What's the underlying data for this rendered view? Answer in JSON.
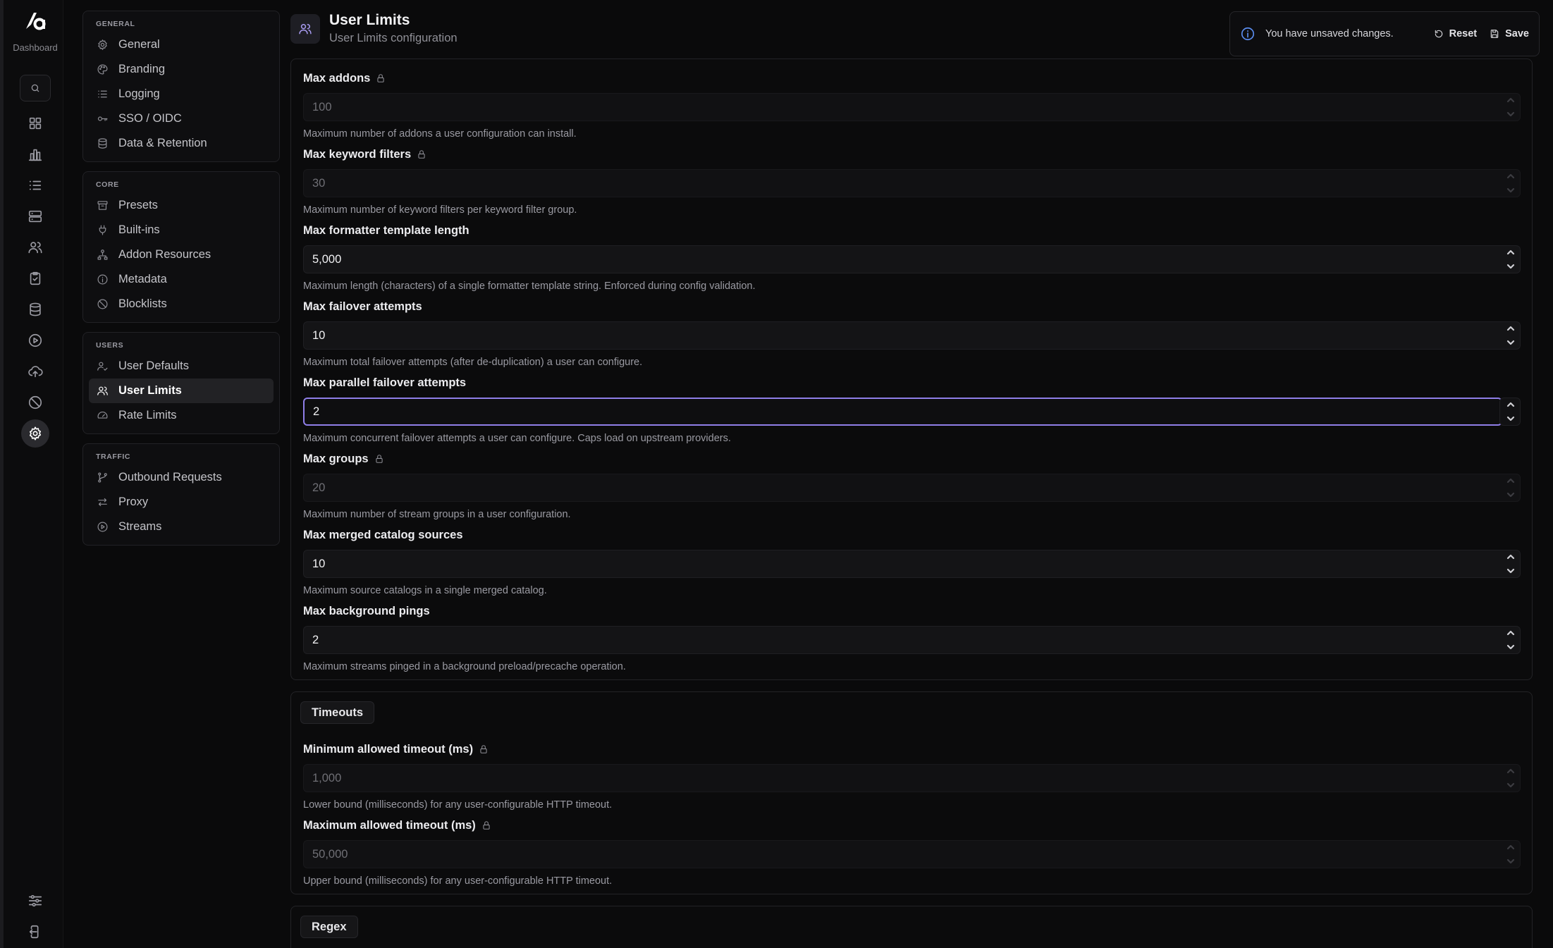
{
  "rail": {
    "logo_label": "Dashboard",
    "icons": [
      "search-icon",
      "grid-icon",
      "bar-chart-icon",
      "list-icon",
      "server-icon",
      "users-icon",
      "clipboard-check-icon",
      "database-icon",
      "play-circle-icon",
      "cloud-upload-icon",
      "ban-icon",
      "settings-icon",
      "sliders-icon",
      "logout-icon"
    ],
    "active": "settings-icon"
  },
  "nav": {
    "general": {
      "title": "GENERAL",
      "items": [
        {
          "label": "General",
          "icon": "gear-icon"
        },
        {
          "label": "Branding",
          "icon": "palette-icon"
        },
        {
          "label": "Logging",
          "icon": "list-icon"
        },
        {
          "label": "SSO / OIDC",
          "icon": "key-icon"
        },
        {
          "label": "Data & Retention",
          "icon": "database-icon"
        }
      ]
    },
    "core": {
      "title": "CORE",
      "items": [
        {
          "label": "Presets",
          "icon": "archive-icon"
        },
        {
          "label": "Built-ins",
          "icon": "plug-icon"
        },
        {
          "label": "Addon Resources",
          "icon": "network-icon"
        },
        {
          "label": "Metadata",
          "icon": "info-icon"
        },
        {
          "label": "Blocklists",
          "icon": "ban-icon"
        }
      ]
    },
    "users": {
      "title": "USERS",
      "items": [
        {
          "label": "User Defaults",
          "icon": "user-check-icon"
        },
        {
          "label": "User Limits",
          "icon": "users-icon",
          "active": true
        },
        {
          "label": "Rate Limits",
          "icon": "gauge-icon"
        }
      ]
    },
    "traffic": {
      "title": "TRAFFIC",
      "items": [
        {
          "label": "Outbound Requests",
          "icon": "git-branch-icon"
        },
        {
          "label": "Proxy",
          "icon": "arrows-exchange-icon"
        },
        {
          "label": "Streams",
          "icon": "play-circle-icon"
        }
      ]
    }
  },
  "header": {
    "title": "User Limits",
    "subtitle": "User Limits configuration",
    "icon": "users-icon"
  },
  "unsaved_bar": {
    "message": "You have unsaved changes.",
    "reset_label": "Reset",
    "save_label": "Save"
  },
  "limits": [
    {
      "label": "Max addons",
      "value": "100",
      "locked": true,
      "help": "Maximum number of addons a user configuration can install."
    },
    {
      "label": "Max keyword filters",
      "value": "30",
      "locked": true,
      "help": "Maximum number of keyword filters per keyword filter group."
    },
    {
      "label": "Max formatter template length",
      "value": "5,000",
      "locked": false,
      "help": "Maximum length (characters) of a single formatter template string. Enforced during config validation."
    },
    {
      "label": "Max failover attempts",
      "value": "10",
      "locked": false,
      "help": "Maximum total failover attempts (after de-duplication) a user can configure."
    },
    {
      "label": "Max parallel failover attempts",
      "value": "2",
      "locked": false,
      "focused": true,
      "help": "Maximum concurrent failover attempts a user can configure. Caps load on upstream providers."
    },
    {
      "label": "Max groups",
      "value": "20",
      "locked": true,
      "help": "Maximum number of stream groups in a user configuration."
    },
    {
      "label": "Max merged catalog sources",
      "value": "10",
      "locked": false,
      "help": "Maximum source catalogs in a single merged catalog."
    },
    {
      "label": "Max background pings",
      "value": "2",
      "locked": false,
      "help": "Maximum streams pinged in a background preload/precache operation."
    }
  ],
  "timeouts": {
    "title": "Timeouts",
    "fields": [
      {
        "label": "Minimum allowed timeout (ms)",
        "value": "1,000",
        "locked": true,
        "help": "Lower bound (milliseconds) for any user-configurable HTTP timeout."
      },
      {
        "label": "Maximum allowed timeout (ms)",
        "value": "50,000",
        "locked": true,
        "help": "Upper bound (milliseconds) for any user-configurable HTTP timeout."
      }
    ]
  },
  "regex": {
    "title": "Regex"
  },
  "colors": {
    "accent": "#8f7ee8",
    "info": "#5b8df0",
    "background": "#0a0a0b"
  }
}
